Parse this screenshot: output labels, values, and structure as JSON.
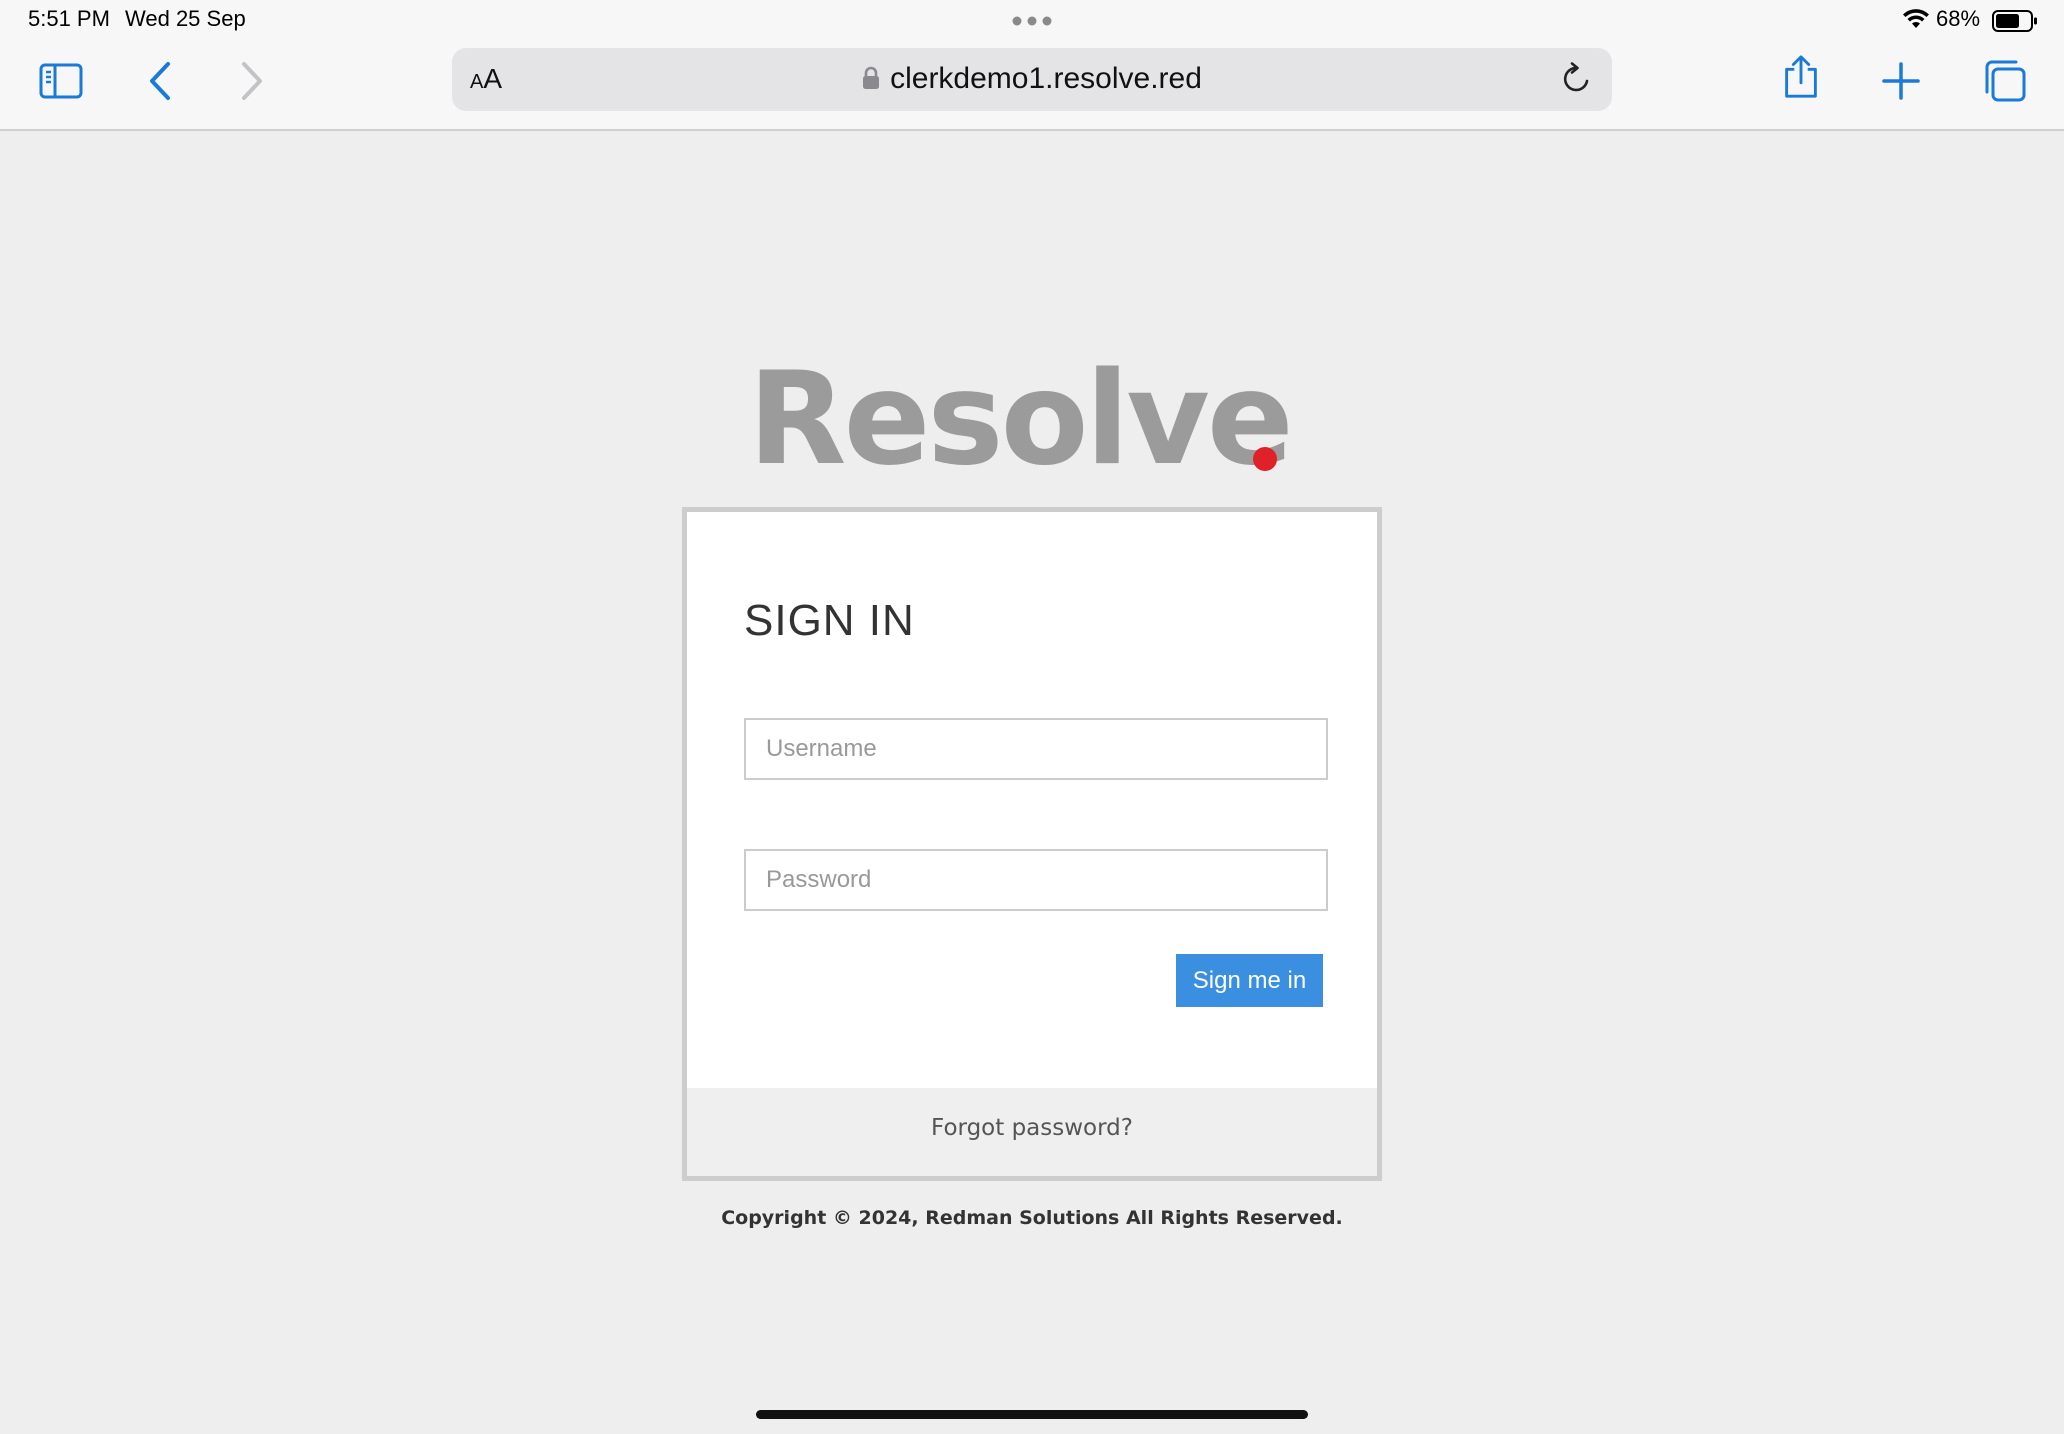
{
  "status_bar": {
    "time": "5:51 PM",
    "date": "Wed 25 Sep",
    "battery": "68%"
  },
  "toolbar": {
    "text_size_label_small": "A",
    "text_size_label_large": "A",
    "url": "clerkdemo1.resolve.red"
  },
  "icons": {
    "sidebar": "sidebar-icon",
    "back": "chevron-left-icon",
    "forward": "chevron-right-icon",
    "lock": "lock-icon",
    "reload": "reload-icon",
    "share": "share-icon",
    "new_tab": "plus-icon",
    "tabs": "tabs-icon",
    "wifi": "wifi-icon",
    "battery": "battery-icon"
  },
  "logo": {
    "text": "Resolve"
  },
  "login": {
    "title": "SIGN IN",
    "username_placeholder": "Username",
    "password_placeholder": "Password",
    "submit_label": "Sign me in",
    "forgot_label": "Forgot password?"
  },
  "footer": {
    "copyright": "Copyright © 2024, Redman Solutions All Rights Reserved."
  },
  "colors": {
    "accent_blue": "#3a8fe0",
    "logo_gray": "#9b9b9b",
    "logo_dot_red": "#e12128",
    "page_background": "#eeeeee",
    "safari_blue": "#1a7ad9"
  }
}
